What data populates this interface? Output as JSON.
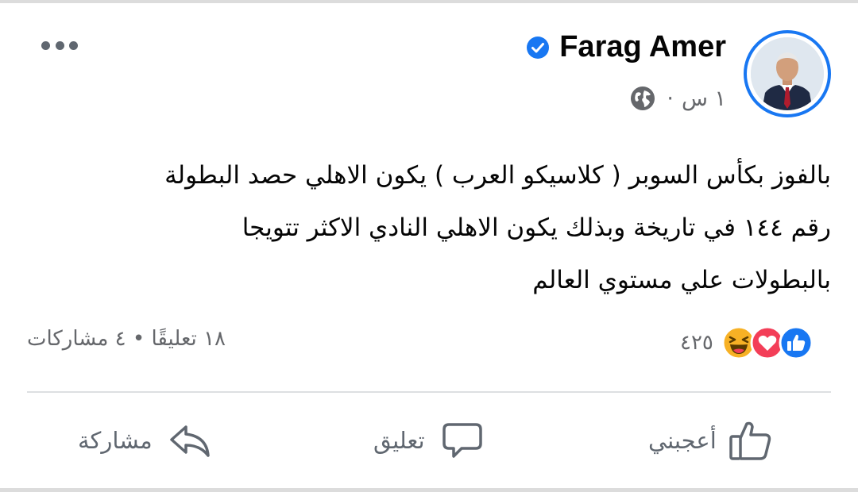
{
  "post": {
    "author": "Farag Amer",
    "time": "١ س",
    "separator": "·",
    "text": "بالفوز بكأس السوبر ( كلاسيكو العرب ) يكون الاهلي حصد البطولة\nرقم ١٤٤ في تاريخة وبذلك يكون الاهلي النادي الاكثر  تتويجا\nبالبطولات علي مستوي العالم"
  },
  "reactions": {
    "count": "٤٢٥",
    "icons": [
      "like-icon",
      "love-icon",
      "haha-icon"
    ]
  },
  "stats": {
    "comments": "١٨ تعليقًا",
    "dot": "•",
    "shares": "٤ مشاركات"
  },
  "actions": {
    "like": "أعجبني",
    "comment": "تعليق",
    "share": "مشاركة"
  },
  "colors": {
    "accent": "#1877f2",
    "love": "#f33e58",
    "haha": "#f7b125",
    "secondary_text": "#65676b"
  }
}
